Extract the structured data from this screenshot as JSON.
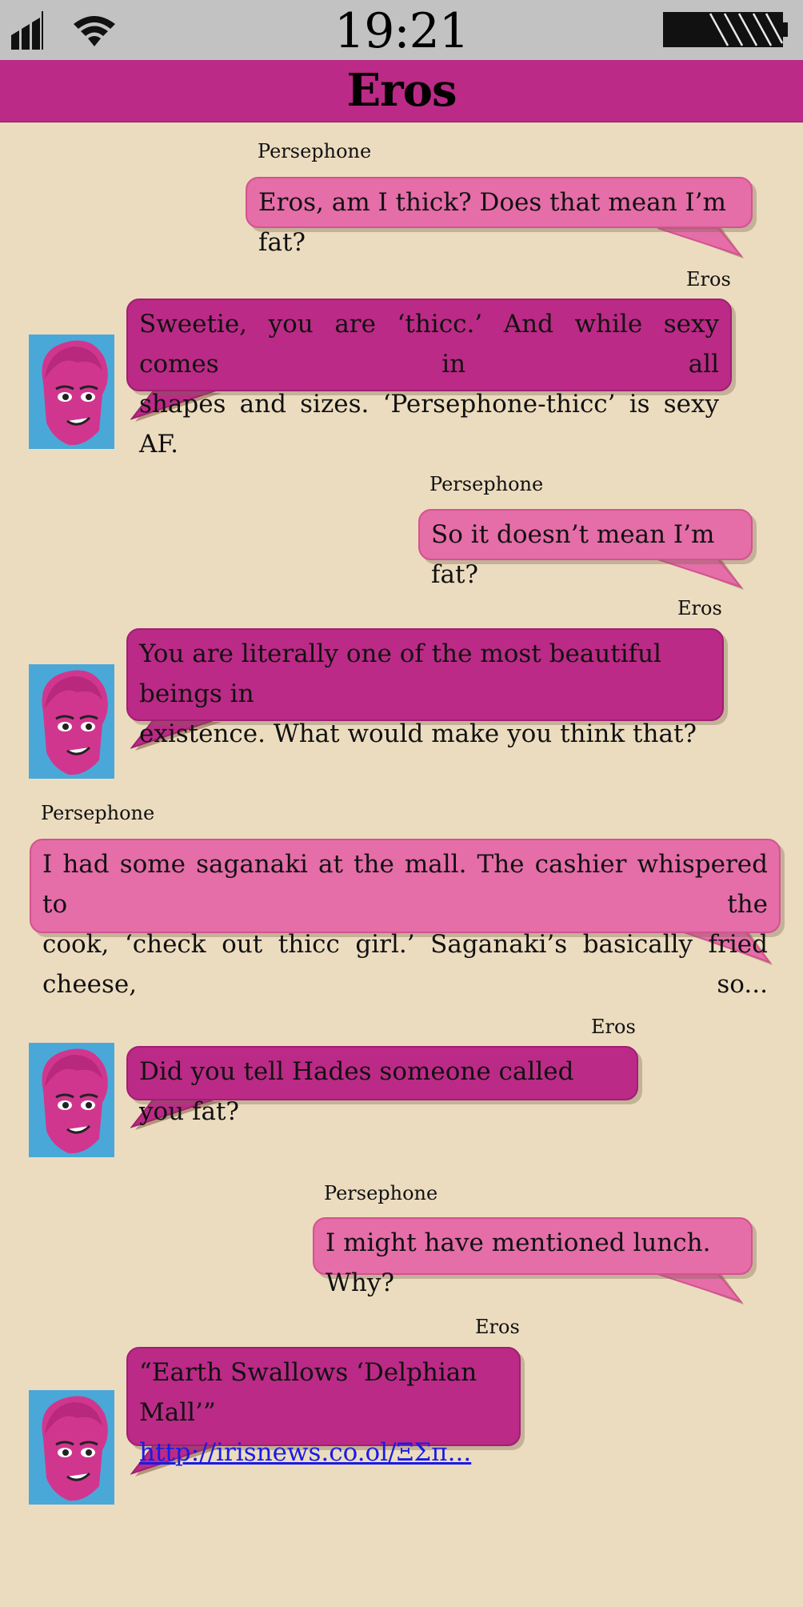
{
  "status": {
    "time": "19:21"
  },
  "header": {
    "title": "Eros"
  },
  "colors": {
    "persephone_bubble": "#e56da8",
    "eros_bubble": "#bb2a86",
    "header_bar": "#bb2a86",
    "status_bar": "#c2c2c2",
    "background": "#ecdcbf",
    "link": "#1a1ae8"
  },
  "messages": [
    {
      "sender": "Persephone",
      "text": "Eros, am I thick? Does that mean I’m fat?"
    },
    {
      "sender": "Eros",
      "lines": [
        "Sweetie, you are ‘thicc.’ And while sexy comes in all",
        "shapes and sizes. ‘Persephone-thicc’ is sexy AF."
      ]
    },
    {
      "sender": "Persephone",
      "text": "So it doesn’t mean I’m fat?"
    },
    {
      "sender": "Eros",
      "lines": [
        "You are literally one of the most beautiful beings in",
        "existence. What would make you think that?"
      ]
    },
    {
      "sender": "Persephone",
      "lines": [
        "I had some saganaki at the mall. The cashier whispered to the",
        "cook, ‘check out thicc girl.’ Saganaki’s basically fried cheese, so..."
      ]
    },
    {
      "sender": "Eros",
      "text": "Did you tell Hades someone called you fat?"
    },
    {
      "sender": "Persephone",
      "text": "I might have mentioned lunch. Why?"
    },
    {
      "sender": "Eros",
      "text": "“Earth Swallows ‘Delphian Mall’”",
      "link": "http://irisnews.co.ol/ΞΣπ..."
    }
  ],
  "icons": [
    "signal-icon",
    "wifi-icon",
    "battery-icon",
    "eros-avatar"
  ]
}
